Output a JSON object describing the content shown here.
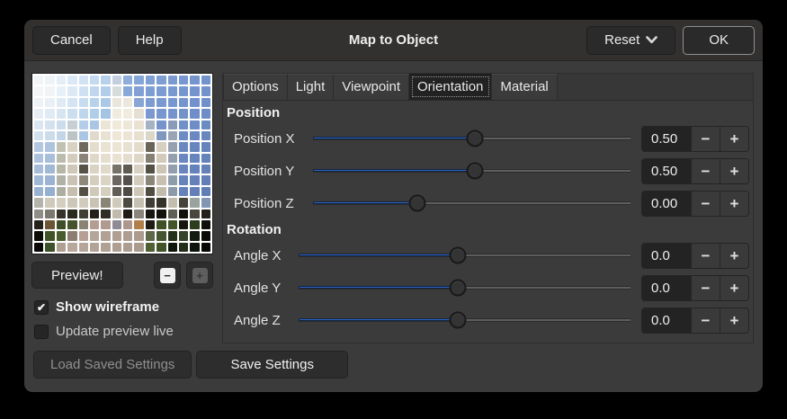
{
  "window": {
    "title": "Map to Object"
  },
  "headerbar": {
    "cancel": "Cancel",
    "help": "Help",
    "reset": "Reset",
    "ok": "OK"
  },
  "icons": {
    "check": "✔",
    "minus": "−",
    "plus": "+",
    "zoom_out": "−",
    "zoom_in": "+",
    "chevron_down": "⌄"
  },
  "colors": {
    "accent": "#2a64be",
    "wireframe": "#ffffff"
  },
  "tabs": [
    {
      "label": "Options",
      "active": false
    },
    {
      "label": "Light",
      "active": false
    },
    {
      "label": "Viewpoint",
      "active": false
    },
    {
      "label": "Orientation",
      "active": true
    },
    {
      "label": "Material",
      "active": false
    }
  ],
  "preview": {
    "button_label": "Preview!",
    "grid_colors": [
      [
        "#f2f4f6",
        "#eef3f7",
        "#e5eef7",
        "#dbe8f5",
        "#d0e2f4",
        "#c4daf1",
        "#b7d1ed",
        "#c3cfdf",
        "#8fadda",
        "#86a6d7",
        "#809fd4",
        "#7d9dd3",
        "#7a9ad1",
        "#7897d0",
        "#7595ce",
        "#7293cc"
      ],
      [
        "#f4f5f6",
        "#f0f4f7",
        "#e7f0f7",
        "#dce9f5",
        "#cfe0f2",
        "#bfd6ee",
        "#b2cdea",
        "#d6dcda",
        "#88a8d8",
        "#839fd5",
        "#7e9ed3",
        "#7b9bd2",
        "#7899d0",
        "#7696cf",
        "#7394cd",
        "#7192cb"
      ],
      [
        "#eef2f6",
        "#e9eff5",
        "#dfeaf4",
        "#d4e4f2",
        "#c7dcef",
        "#b8d2ec",
        "#abc9e7",
        "#e9e5db",
        "#ece7dc",
        "#88a5d4",
        "#7d9cd2",
        "#7a99d0",
        "#7797cf",
        "#7495cd",
        "#7292cb",
        "#6f90c9"
      ],
      [
        "#e7edf4",
        "#e1eaf3",
        "#d7e5f1",
        "#cbdeef",
        "#bed6ec",
        "#b0cde9",
        "#a4c4e4",
        "#f0ebdf",
        "#f2ecdf",
        "#e4dfd2",
        "#7b99d0",
        "#7897ce",
        "#7594cc",
        "#7392ca",
        "#708fc8",
        "#6e8dc6"
      ],
      [
        "#dce6f0",
        "#d5e2ee",
        "#cbdcec",
        "#c8cfd4",
        "#b3cce7",
        "#abc6e3",
        "#ece5d6",
        "#f0e9da",
        "#eee7d8",
        "#e9e2d3",
        "#a4b2c4",
        "#7594cb",
        "#8a9bb8",
        "#7090c7",
        "#6d8dc5",
        "#6b8bc3"
      ],
      [
        "#d4e0ec",
        "#cddcea",
        "#c3d6e8",
        "#bcc4c6",
        "#abc6e2",
        "#e0dacb",
        "#e9e2d3",
        "#eee7d8",
        "#ece5d6",
        "#e7e0d1",
        "#dcd6c7",
        "#8097c0",
        "#99a4b4",
        "#6d8cc4",
        "#6a89c1",
        "#6887bf"
      ],
      [
        "#b4c8e1",
        "#aec3de",
        "#c2c2b2",
        "#d9d2c3",
        "#6e695c",
        "#e4ddce",
        "#eae3d4",
        "#ece5d6",
        "#e8e1d2",
        "#e3dccd",
        "#6a6558",
        "#d7d0c1",
        "#97a0b0",
        "#6b89c1",
        "#6886be",
        "#6684bc"
      ],
      [
        "#adc2dd",
        "#a8bedb",
        "#bcbcae",
        "#d4cdbe",
        "#8a8478",
        "#dfd8c9",
        "#e6dfd0",
        "#e9e2d3",
        "#e4ddce",
        "#ded7c8",
        "#868072",
        "#d2cbbc",
        "#94a0ae",
        "#6a87bf",
        "#6785bd",
        "#6583bb"
      ],
      [
        "#a6bdd9",
        "#a1b9d7",
        "#b6b7a9",
        "#cfc8b9",
        "#565248",
        "#dad3c4",
        "#e0d9ca",
        "#76716a",
        "#5f5b50",
        "#d8d1c2",
        "#545046",
        "#cdc6b7",
        "#929eac",
        "#6885bd",
        "#6583bb",
        "#6481b9"
      ],
      [
        "#9fb8d5",
        "#9bb4d3",
        "#b0b2a5",
        "#cac3b4",
        "#8e887b",
        "#d5cebf",
        "#dbd4c5",
        "#6b6660",
        "#55514a",
        "#d3ccbd",
        "#8b8578",
        "#c8c1b2",
        "#8f9ca9",
        "#6783bb",
        "#6481b9",
        "#627fb7"
      ],
      [
        "#99b2d1",
        "#95afd0",
        "#abaea1",
        "#c5beaf",
        "#534f45",
        "#d0c9ba",
        "#d6cfc0",
        "#605c56",
        "#4e4a44",
        "#cec7b8",
        "#514d43",
        "#c3bcad",
        "#8d9aa7",
        "#6581b9",
        "#627fb7",
        "#607db5"
      ],
      [
        "#b4b4ac",
        "#cfc9bb",
        "#d4cec0",
        "#cdc7b9",
        "#d1cbbd",
        "#c9c3b5",
        "#8b8578",
        "#d0cabc",
        "#4e4c42",
        "#c6c0b2",
        "#403e34",
        "#35332a",
        "#c3bdaf",
        "#46443a",
        "#9aa39e",
        "#8296b4"
      ],
      [
        "#8f8d85",
        "#7b796f",
        "#35332a",
        "#2b2920",
        "#413f35",
        "#23211a",
        "#2f2d24",
        "#c0baac",
        "#1e1c15",
        "#8a857a",
        "#181610",
        "#14120c",
        "#615f54",
        "#13110b",
        "#4a483e",
        "#23211a"
      ],
      [
        "#23211a",
        "#6b5436",
        "#3e4e28",
        "#45542c",
        "#8a8272",
        "#b49e94",
        "#b19b91",
        "#8f8a96",
        "#ad978d",
        "#b07f4a",
        "#1c1a13",
        "#3f5026",
        "#435429",
        "#16140e",
        "#2e3c1e",
        "#10100a"
      ],
      [
        "#0d0d08",
        "#415326",
        "#4a5c2e",
        "#8c7f72",
        "#b6a096",
        "#b3a79b",
        "#b2a296",
        "#b09f93",
        "#ae9d91",
        "#ac9b8f",
        "#5e6848",
        "#455631",
        "#23311a",
        "#35432a",
        "#141b10",
        "#0b0b07"
      ],
      [
        "#0a0a06",
        "#3c512a",
        "#b0a094",
        "#b8a89c",
        "#b5a599",
        "#b3a397",
        "#b1a195",
        "#af9f93",
        "#ad9d91",
        "#ab9b8f",
        "#4e6034",
        "#425428",
        "#10150c",
        "#222e18",
        "#0f140c",
        "#070705"
      ]
    ]
  },
  "checkboxes": [
    {
      "label": "Show wireframe",
      "checked": true
    },
    {
      "label": "Update preview live",
      "checked": false
    }
  ],
  "sections": [
    {
      "name": "position",
      "title": "Position",
      "rows": [
        {
          "label": "Position X",
          "value": "0.50",
          "fill": 51
        },
        {
          "label": "Position Y",
          "value": "0.50",
          "fill": 51
        },
        {
          "label": "Position Z",
          "value": "0.00",
          "fill": 33
        }
      ]
    },
    {
      "name": "rotation",
      "title": "Rotation",
      "rows": [
        {
          "label": "Angle X",
          "value": "0.0",
          "fill": 48
        },
        {
          "label": "Angle Y",
          "value": "0.0",
          "fill": 48
        },
        {
          "label": "Angle Z",
          "value": "0.0",
          "fill": 48
        }
      ]
    }
  ],
  "footer": {
    "load": "Load Saved Settings",
    "save": "Save Settings"
  }
}
